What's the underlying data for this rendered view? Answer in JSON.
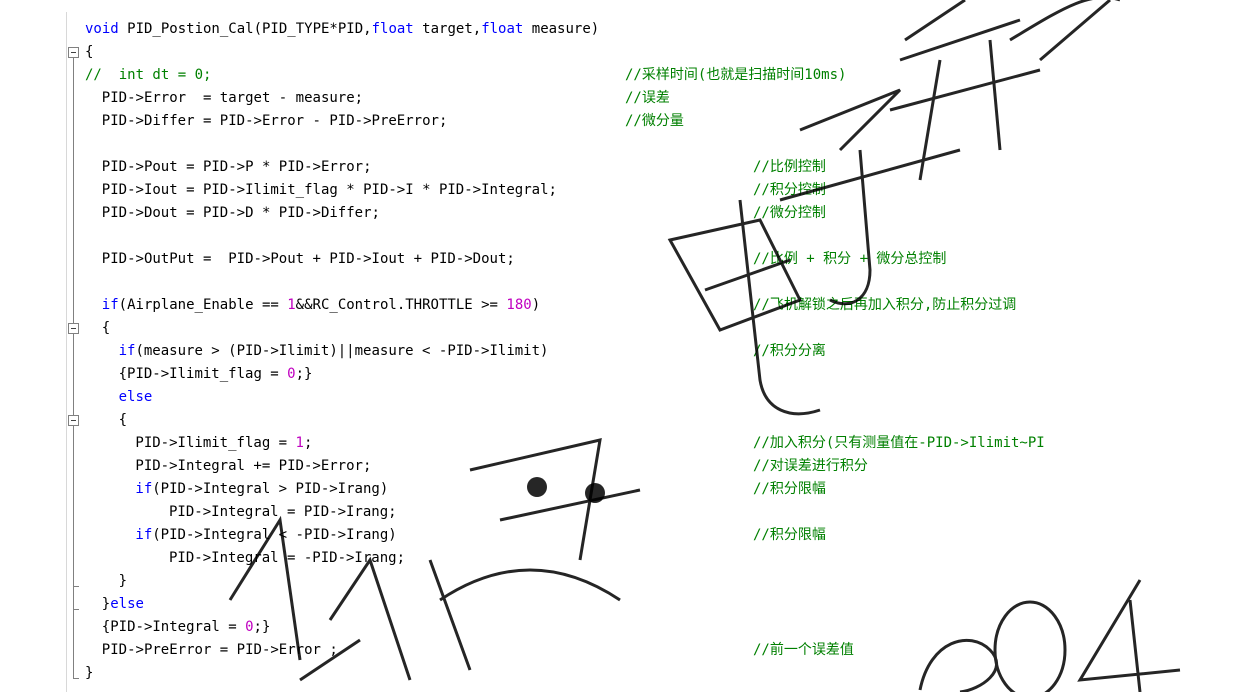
{
  "editor": {
    "lines": [
      {
        "indent": 0,
        "code": [
          {
            "t": "kw",
            "v": "void"
          },
          {
            "t": "",
            "v": " PID_Postion_Cal(PID_TYPE*PID,"
          },
          {
            "t": "kw",
            "v": "float"
          },
          {
            "t": "",
            "v": " target,"
          },
          {
            "t": "kw",
            "v": "float"
          },
          {
            "t": "",
            "v": " measure)"
          }
        ],
        "comment": ""
      },
      {
        "indent": 0,
        "code": [
          {
            "t": "",
            "v": "{"
          }
        ],
        "comment": ""
      },
      {
        "indent": 0,
        "code": [
          {
            "t": "cm",
            "v": "//  int dt = 0;"
          }
        ],
        "comment": "//采样时间(也就是扫描时间10ms)"
      },
      {
        "indent": 1,
        "code": [
          {
            "t": "",
            "v": "PID->Error  = target - measure;"
          }
        ],
        "comment": "//误差"
      },
      {
        "indent": 1,
        "code": [
          {
            "t": "",
            "v": "PID->Differ = PID->Error - PID->PreError;"
          }
        ],
        "comment": "//微分量"
      },
      {
        "indent": 0,
        "code": [],
        "comment": ""
      },
      {
        "indent": 1,
        "code": [
          {
            "t": "",
            "v": "PID->Pout = PID->P * PID->Error;"
          }
        ],
        "comment": "//比例控制"
      },
      {
        "indent": 1,
        "code": [
          {
            "t": "",
            "v": "PID->Iout = PID->Ilimit_flag * PID->I * PID->Integral;"
          }
        ],
        "comment": "//积分控制"
      },
      {
        "indent": 1,
        "code": [
          {
            "t": "",
            "v": "PID->Dout = PID->D * PID->Differ;"
          }
        ],
        "comment": "//微分控制"
      },
      {
        "indent": 0,
        "code": [],
        "comment": ""
      },
      {
        "indent": 1,
        "code": [
          {
            "t": "",
            "v": "PID->OutPut =  PID->Pout + PID->Iout + PID->Dout;"
          }
        ],
        "comment": "//比例 + 积分 + 微分总控制"
      },
      {
        "indent": 0,
        "code": [],
        "comment": ""
      },
      {
        "indent": 1,
        "code": [
          {
            "t": "kw",
            "v": "if"
          },
          {
            "t": "",
            "v": "(Airplane_Enable == "
          },
          {
            "t": "num",
            "v": "1"
          },
          {
            "t": "",
            "v": "&&RC_Control.THROTTLE >= "
          },
          {
            "t": "num",
            "v": "180"
          },
          {
            "t": "",
            "v": ")"
          }
        ],
        "comment": "//飞机解锁之后再加入积分,防止积分过调"
      },
      {
        "indent": 1,
        "code": [
          {
            "t": "",
            "v": "{"
          }
        ],
        "comment": ""
      },
      {
        "indent": 2,
        "code": [
          {
            "t": "kw",
            "v": "if"
          },
          {
            "t": "",
            "v": "(measure > (PID->Ilimit)||measure < -PID->Ilimit)"
          }
        ],
        "comment": "//积分分离"
      },
      {
        "indent": 2,
        "code": [
          {
            "t": "",
            "v": "{PID->Ilimit_flag = "
          },
          {
            "t": "num",
            "v": "0"
          },
          {
            "t": "",
            "v": ";}"
          }
        ],
        "comment": ""
      },
      {
        "indent": 2,
        "code": [
          {
            "t": "kw",
            "v": "else"
          }
        ],
        "comment": ""
      },
      {
        "indent": 2,
        "code": [
          {
            "t": "",
            "v": "{"
          }
        ],
        "comment": ""
      },
      {
        "indent": 3,
        "code": [
          {
            "t": "",
            "v": "PID->Ilimit_flag = "
          },
          {
            "t": "num",
            "v": "1"
          },
          {
            "t": "",
            "v": ";"
          }
        ],
        "comment": "//加入积分(只有测量值在-PID->Ilimit~PI"
      },
      {
        "indent": 3,
        "code": [
          {
            "t": "",
            "v": "PID->Integral += PID->Error;"
          }
        ],
        "comment": "//对误差进行积分"
      },
      {
        "indent": 3,
        "code": [
          {
            "t": "kw",
            "v": "if"
          },
          {
            "t": "",
            "v": "(PID->Integral > PID->Irang)"
          }
        ],
        "comment": "//积分限幅"
      },
      {
        "indent": 5,
        "code": [
          {
            "t": "",
            "v": "PID->Integral = PID->Irang;"
          }
        ],
        "comment": ""
      },
      {
        "indent": 3,
        "code": [
          {
            "t": "kw",
            "v": "if"
          },
          {
            "t": "",
            "v": "(PID->Integral < -PID->Irang)"
          }
        ],
        "comment": "//积分限幅"
      },
      {
        "indent": 5,
        "code": [
          {
            "t": "",
            "v": "PID->Integral = -PID->Irang;"
          }
        ],
        "comment": ""
      },
      {
        "indent": 2,
        "code": [
          {
            "t": "",
            "v": "}"
          }
        ],
        "comment": ""
      },
      {
        "indent": 1,
        "code": [
          {
            "t": "",
            "v": "}"
          },
          {
            "t": "kw",
            "v": "else"
          }
        ],
        "comment": ""
      },
      {
        "indent": 1,
        "code": [
          {
            "t": "",
            "v": "{PID->Integral = "
          },
          {
            "t": "num",
            "v": "0"
          },
          {
            "t": "",
            "v": ";}"
          }
        ],
        "comment": ""
      },
      {
        "indent": 1,
        "code": [
          {
            "t": "",
            "v": "PID->PreError = PID->Error ;"
          }
        ],
        "comment": "//前一个误差值"
      },
      {
        "indent": 0,
        "code": [
          {
            "t": "",
            "v": "}"
          }
        ],
        "comment": ""
      }
    ]
  },
  "colors": {
    "keyword": "#0000ff",
    "number": "#c000c0",
    "comment": "#008000",
    "text": "#000000"
  },
  "watermark_text": "电子开发  公众号：  204"
}
